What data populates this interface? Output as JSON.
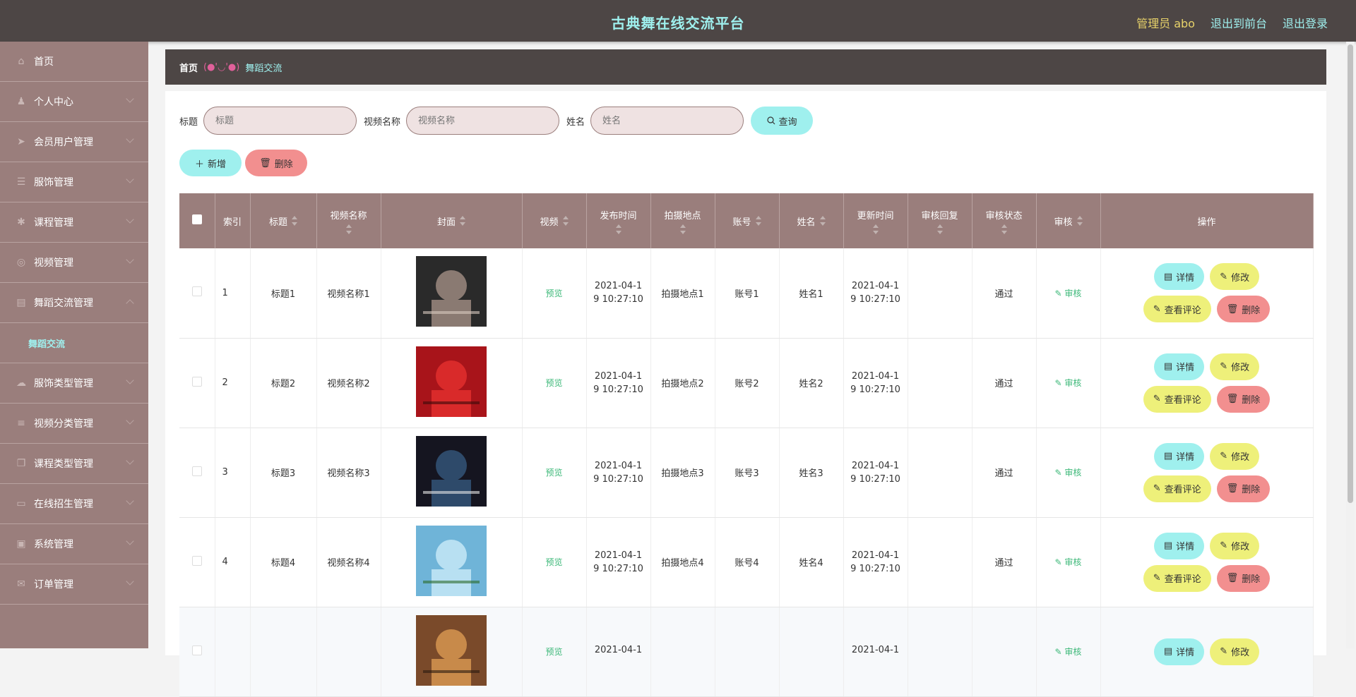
{
  "header": {
    "title": "古典舞在线交流平台",
    "admin": "管理员 abo",
    "to_front": "退出到前台",
    "logout": "退出登录"
  },
  "sidebar": {
    "items": [
      {
        "label": "首页",
        "icon": "home-icon"
      },
      {
        "label": "个人中心",
        "icon": "user-icon"
      },
      {
        "label": "会员用户管理",
        "icon": "send-icon"
      },
      {
        "label": "服饰管理",
        "icon": "list-icon"
      },
      {
        "label": "课程管理",
        "icon": "bulb-icon"
      },
      {
        "label": "视频管理",
        "icon": "compass-icon"
      },
      {
        "label": "舞蹈交流管理",
        "icon": "doc-icon"
      }
    ],
    "sub_item": "舞蹈交流",
    "items2": [
      {
        "label": "服饰类型管理",
        "icon": "cloud-icon"
      },
      {
        "label": "视频分类管理",
        "icon": "menu-icon"
      },
      {
        "label": "课程类型管理",
        "icon": "copy-icon"
      },
      {
        "label": "在线招生管理",
        "icon": "store-icon"
      },
      {
        "label": "系统管理",
        "icon": "lock-icon"
      },
      {
        "label": "订单管理",
        "icon": "mail-icon"
      }
    ]
  },
  "breadcrumb": {
    "home": "首页",
    "sep": "(●'◡'●)",
    "current": "舞蹈交流"
  },
  "search": {
    "title_label": "标题",
    "title_ph": "标题",
    "video_label": "视频名称",
    "video_ph": "视频名称",
    "name_label": "姓名",
    "name_ph": "姓名",
    "query": "查询"
  },
  "actions": {
    "add": "新增",
    "delete": "删除"
  },
  "table": {
    "headers": [
      "索引",
      "标题",
      "视频名称",
      "封面",
      "视频",
      "发布时间",
      "拍摄地点",
      "账号",
      "姓名",
      "更新时间",
      "审核回复",
      "审核状态",
      "审核",
      "操作"
    ],
    "rows": [
      {
        "idx": "1",
        "title": "标题1",
        "video": "视频名称1",
        "preview": "预览",
        "pub_a": "2021-04-1",
        "pub_b": "9 10:27:10",
        "loc": "拍摄地点1",
        "acct": "账号1",
        "name": "姓名1",
        "upd_a": "2021-04-1",
        "upd_b": "9 10:27:10",
        "reply": "",
        "status": "通过",
        "audit": "审核"
      },
      {
        "idx": "2",
        "title": "标题2",
        "video": "视频名称2",
        "preview": "预览",
        "pub_a": "2021-04-1",
        "pub_b": "9 10:27:10",
        "loc": "拍摄地点2",
        "acct": "账号2",
        "name": "姓名2",
        "upd_a": "2021-04-1",
        "upd_b": "9 10:27:10",
        "reply": "",
        "status": "通过",
        "audit": "审核"
      },
      {
        "idx": "3",
        "title": "标题3",
        "video": "视频名称3",
        "preview": "预览",
        "pub_a": "2021-04-1",
        "pub_b": "9 10:27:10",
        "loc": "拍摄地点3",
        "acct": "账号3",
        "name": "姓名3",
        "upd_a": "2021-04-1",
        "upd_b": "9 10:27:10",
        "reply": "",
        "status": "通过",
        "audit": "审核"
      },
      {
        "idx": "4",
        "title": "标题4",
        "video": "视频名称4",
        "preview": "预览",
        "pub_a": "2021-04-1",
        "pub_b": "9 10:27:10",
        "loc": "拍摄地点4",
        "acct": "账号4",
        "name": "姓名4",
        "upd_a": "2021-04-1",
        "upd_b": "9 10:27:10",
        "reply": "",
        "status": "通过",
        "audit": "审核"
      },
      {
        "idx": "",
        "title": "",
        "video": "",
        "preview": "预览",
        "pub_a": "2021-04-1",
        "pub_b": "",
        "loc": "",
        "acct": "",
        "name": "",
        "upd_a": "2021-04-1",
        "upd_b": "",
        "reply": "",
        "status": "",
        "audit": "审核"
      }
    ],
    "op_labels": {
      "detail": "详情",
      "edit": "修改",
      "comments": "查看评论",
      "delete": "删除"
    }
  },
  "colors": {
    "topbar": "#4d4645",
    "sidebar": "#9a7e7c",
    "accent_cyan": "#9ff0ee",
    "accent_yellow": "#eef07a",
    "accent_pink": "#f28f8f"
  }
}
